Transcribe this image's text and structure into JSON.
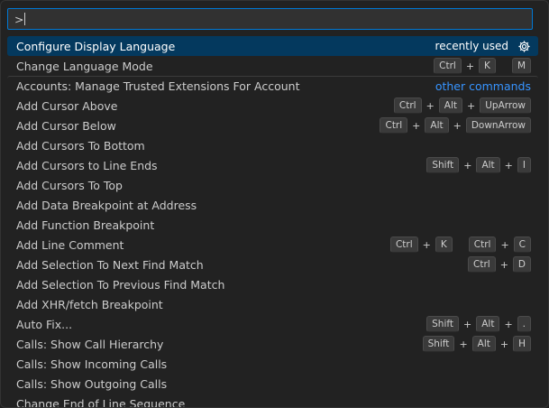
{
  "input": {
    "value": ">"
  },
  "items": [
    {
      "label": "Configure Display Language",
      "tag": "recently used",
      "selected": true,
      "gear": true
    },
    {
      "label": "Change Language Mode",
      "keys": [
        [
          "Ctrl",
          "K"
        ],
        [
          "M"
        ]
      ]
    },
    {
      "label": "Accounts: Manage Trusted Extensions For Account",
      "link": "other commands",
      "separator": true
    },
    {
      "label": "Add Cursor Above",
      "keys": [
        [
          "Ctrl",
          "Alt",
          "UpArrow"
        ]
      ]
    },
    {
      "label": "Add Cursor Below",
      "keys": [
        [
          "Ctrl",
          "Alt",
          "DownArrow"
        ]
      ]
    },
    {
      "label": "Add Cursors To Bottom"
    },
    {
      "label": "Add Cursors to Line Ends",
      "keys": [
        [
          "Shift",
          "Alt",
          "I"
        ]
      ]
    },
    {
      "label": "Add Cursors To Top"
    },
    {
      "label": "Add Data Breakpoint at Address"
    },
    {
      "label": "Add Function Breakpoint"
    },
    {
      "label": "Add Line Comment",
      "keys": [
        [
          "Ctrl",
          "K"
        ],
        [
          "Ctrl",
          "C"
        ]
      ]
    },
    {
      "label": "Add Selection To Next Find Match",
      "keys": [
        [
          "Ctrl",
          "D"
        ]
      ]
    },
    {
      "label": "Add Selection To Previous Find Match"
    },
    {
      "label": "Add XHR/fetch Breakpoint"
    },
    {
      "label": "Auto Fix...",
      "keys": [
        [
          "Shift",
          "Alt",
          "."
        ]
      ]
    },
    {
      "label": "Calls: Show Call Hierarchy",
      "keys": [
        [
          "Shift",
          "Alt",
          "H"
        ]
      ]
    },
    {
      "label": "Calls: Show Incoming Calls"
    },
    {
      "label": "Calls: Show Outgoing Calls"
    },
    {
      "label": "Change End of Line Sequence"
    }
  ]
}
